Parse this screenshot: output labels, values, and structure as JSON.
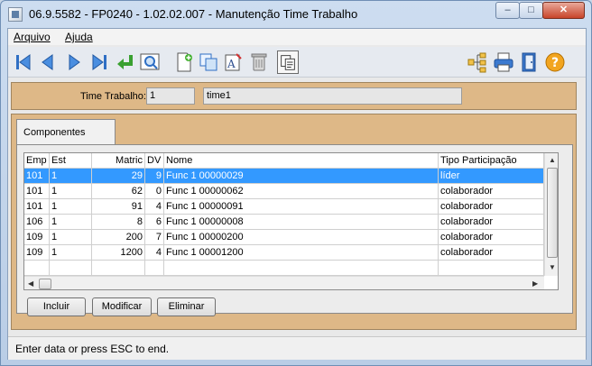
{
  "window": {
    "title": "06.9.5582 - FP0240 - 1.02.02.007 - Manutenção Time Trabalho",
    "controls": {
      "minimize": "–",
      "maximize": "□",
      "close": "✕"
    }
  },
  "menu": {
    "items": [
      "Arquivo",
      "Ajuda"
    ]
  },
  "toolbar": {
    "icons": [
      "first-record-icon",
      "previous-record-icon",
      "next-record-icon",
      "last-record-icon",
      "goto-icon",
      "search-icon",
      "new-icon",
      "copy-icon",
      "edit-icon",
      "delete-icon",
      "paste-icon",
      "tree-icon",
      "print-icon",
      "exit-icon",
      "help-icon"
    ]
  },
  "header": {
    "label": "Time Trabalho:",
    "code": "1",
    "description": "time1"
  },
  "tabs": [
    {
      "label": "Componentes"
    }
  ],
  "grid": {
    "columns": [
      "Emp",
      "Est",
      "Matric",
      "DV",
      "Nome",
      "Tipo Participação"
    ],
    "rows": [
      [
        "101",
        "1",
        "29",
        "9",
        "Func 1  00000029",
        "líder"
      ],
      [
        "101",
        "1",
        "62",
        "0",
        "Func 1  00000062",
        "colaborador"
      ],
      [
        "101",
        "1",
        "91",
        "4",
        "Func 1  00000091",
        "colaborador"
      ],
      [
        "106",
        "1",
        "8",
        "6",
        "Func 1  00000008",
        "colaborador"
      ],
      [
        "109",
        "1",
        "200",
        "7",
        "Func 1  00000200",
        "colaborador"
      ],
      [
        "109",
        "1",
        "1200",
        "4",
        "Func 1  00001200",
        "colaborador"
      ]
    ],
    "selected_row": 0
  },
  "buttons": {
    "add": "Incluir",
    "edit": "Modificar",
    "delete": "Eliminar"
  },
  "status": {
    "text": "Enter data or press ESC to end."
  },
  "colors": {
    "panel": "#deb887",
    "selection": "#3399ff"
  }
}
